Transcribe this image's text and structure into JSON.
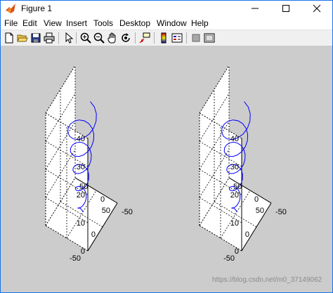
{
  "window": {
    "title": "Figure 1",
    "controls": [
      "minimize-icon",
      "maximize-icon",
      "close-icon"
    ]
  },
  "menu": {
    "file": "File",
    "edit": "Edit",
    "view": "View",
    "insert": "Insert",
    "tools": "Tools",
    "desktop": "Desktop",
    "window": "Window",
    "help": "Help"
  },
  "toolbar": {
    "icons": [
      "new-figure-icon",
      "open-file-icon",
      "save-icon",
      "print-icon",
      "edit-plot-arrow-icon",
      "zoom-in-icon",
      "zoom-out-icon",
      "pan-hand-icon",
      "rotate-3d-icon",
      "data-cursor-icon",
      "colorbar-icon",
      "legend-icon",
      "hide-plot-tools-icon",
      "show-plot-tools-icon"
    ]
  },
  "plots": {
    "left": {
      "z_ticks": [
        "40",
        "30",
        "20",
        "10",
        "0"
      ],
      "y_ticks": [
        "50",
        "0",
        "-50"
      ],
      "x_ticks": [
        "50",
        "0",
        "-50"
      ]
    },
    "right": {
      "z_ticks": [
        "40",
        "30",
        "20",
        "10",
        "0"
      ],
      "y_ticks": [
        "50",
        "0",
        "-50"
      ],
      "x_ticks": [
        "50",
        "0",
        "-50"
      ]
    }
  },
  "chart_data": [
    {
      "type": "line",
      "subtype": "3d-helix",
      "x_range": [
        -50,
        50
      ],
      "y_range": [
        -50,
        50
      ],
      "z_range": [
        0,
        40
      ],
      "z_ticks": [
        0,
        10,
        20,
        30,
        40
      ],
      "grid": true,
      "line_color": "#0000ff",
      "series": [
        {
          "turns": 5,
          "radius_start": 5,
          "radius_end": 30,
          "z_start": 0,
          "z_end": 35
        }
      ]
    },
    {
      "type": "line",
      "subtype": "3d-helix",
      "x_range": [
        -50,
        50
      ],
      "y_range": [
        -50,
        50
      ],
      "z_range": [
        0,
        40
      ],
      "z_ticks": [
        0,
        10,
        20,
        30,
        40
      ],
      "grid": true,
      "line_color": "#0000ff",
      "series": [
        {
          "turns": 5,
          "radius_start": 5,
          "radius_end": 30,
          "z_start": 0,
          "z_end": 35
        }
      ]
    }
  ],
  "watermark": "https://blog.csdn.net/m0_37149062"
}
